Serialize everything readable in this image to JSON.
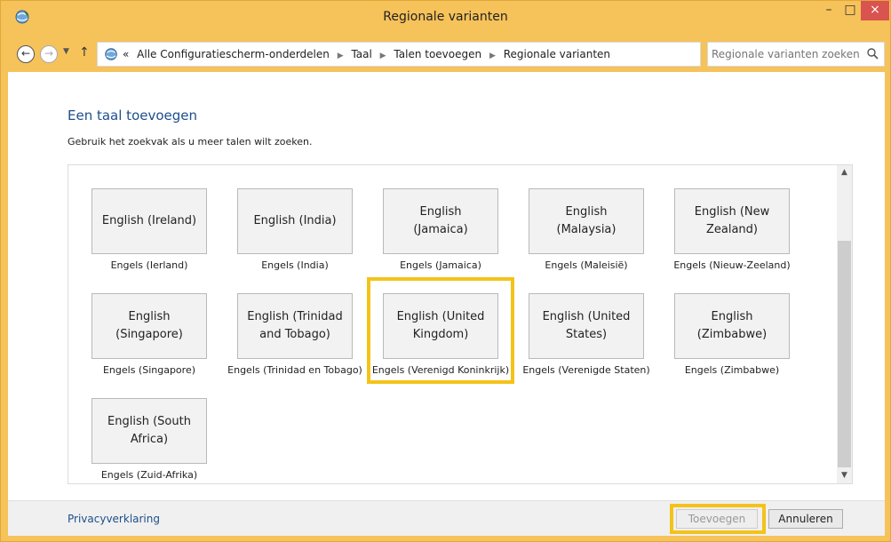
{
  "window": {
    "title": "Regionale varianten",
    "minimize": "–",
    "maximize": "□",
    "close": "×"
  },
  "addressbar": {
    "back_icon": "back-arrow-icon",
    "forward_icon": "forward-arrow-icon",
    "breadcrumb_prefix": "«",
    "breadcrumb": [
      "Alle Configuratiescherm-onderdelen",
      "Taal",
      "Talen toevoegen",
      "Regionale varianten"
    ],
    "separator": "▶",
    "search_placeholder": "Regionale varianten zoeken"
  },
  "main": {
    "heading": "Een taal toevoegen",
    "subtext": "Gebruik het zoekvak als u meer talen wilt zoeken."
  },
  "languages": [
    {
      "tile": "English (Ireland)",
      "caption": "Engels (Ierland)"
    },
    {
      "tile": "English (India)",
      "caption": "Engels (India)"
    },
    {
      "tile": "English (Jamaica)",
      "caption": "Engels (Jamaica)"
    },
    {
      "tile": "English (Malaysia)",
      "caption": "Engels (Maleisië)"
    },
    {
      "tile": "English (New Zealand)",
      "caption": "Engels (Nieuw-Zeeland)"
    },
    {
      "tile": "English (Singapore)",
      "caption": "Engels (Singapore)"
    },
    {
      "tile": "English (Trinidad and Tobago)",
      "caption": "Engels (Trinidad en Tobago)"
    },
    {
      "tile": "English (United Kingdom)",
      "caption": "Engels (Verenigd Koninkrijk)",
      "selected": true
    },
    {
      "tile": "English (United States)",
      "caption": "Engels (Verenigde Staten)"
    },
    {
      "tile": "English (Zimbabwe)",
      "caption": "Engels (Zimbabwe)"
    },
    {
      "tile": "English (South Africa)",
      "caption": "Engels (Zuid-Afrika)"
    }
  ],
  "footer": {
    "privacy_link": "Privacyverklaring",
    "add_button": "Toevoegen",
    "cancel_button": "Annuleren"
  },
  "colors": {
    "titlebar": "#f6c25a",
    "highlight": "#f4c31a",
    "link": "#1e4e8c"
  }
}
